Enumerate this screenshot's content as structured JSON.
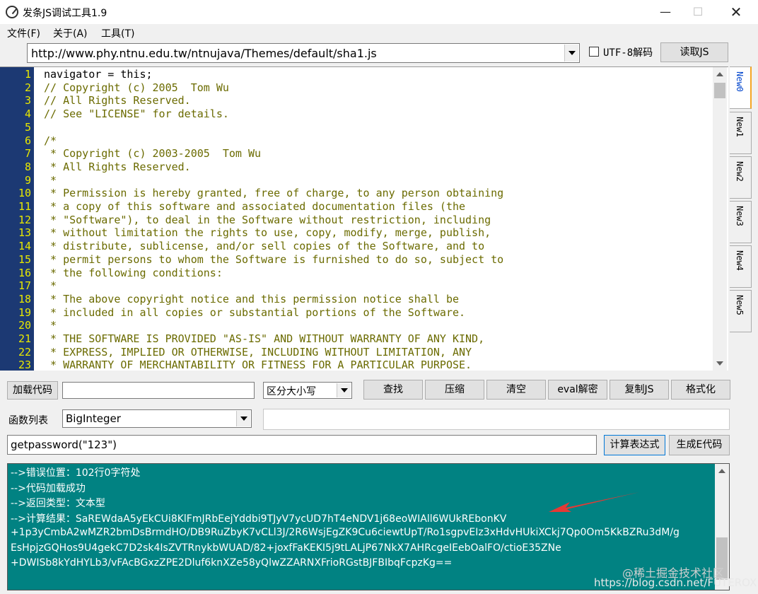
{
  "window": {
    "title": "发条JS调试工具1.9",
    "minimize": "—",
    "maximize": "☐",
    "close": "✕"
  },
  "menu": [
    "文件(F)",
    "关于(A)",
    "工具(T)"
  ],
  "url_bar": {
    "value": "http://www.phy.ntnu.edu.tw/ntnujava/Themes/default/sha1.js",
    "utf8_label": "UTF-8解码",
    "utf8_checked": false,
    "read_button": "读取JS"
  },
  "editor": {
    "line_numbers": [
      "1",
      "2",
      "3",
      "4",
      "5",
      "6",
      "7",
      "8",
      "9",
      "10",
      "11",
      "12",
      "13",
      "14",
      "15",
      "16",
      "17",
      "18",
      "19",
      "20",
      "21",
      "22",
      "23"
    ],
    "lines": [
      "navigator = this;",
      "// Copyright (c) 2005  Tom Wu",
      "// All Rights Reserved.",
      "// See \"LICENSE\" for details.",
      "",
      "/*",
      " * Copyright (c) 2003-2005  Tom Wu",
      " * All Rights Reserved.",
      " *",
      " * Permission is hereby granted, free of charge, to any person obtaining",
      " * a copy of this software and associated documentation files (the",
      " * \"Software\"), to deal in the Software without restriction, including",
      " * without limitation the rights to use, copy, modify, merge, publish,",
      " * distribute, sublicense, and/or sell copies of the Software, and to",
      " * permit persons to whom the Software is furnished to do so, subject to",
      " * the following conditions:",
      " *",
      " * The above copyright notice and this permission notice shall be",
      " * included in all copies or substantial portions of the Software.",
      " *",
      " * THE SOFTWARE IS PROVIDED \"AS-IS\" AND WITHOUT WARRANTY OF ANY KIND,",
      " * EXPRESS, IMPLIED OR OTHERWISE, INCLUDING WITHOUT LIMITATION, ANY",
      " * WARRANTY OF MERCHANTABILITY OR FITNESS FOR A PARTICULAR PURPOSE."
    ],
    "tabs": [
      "New0",
      "New1",
      "New2",
      "New3",
      "New4",
      "New5"
    ],
    "active_tab": "New0"
  },
  "toolbar": {
    "load_code": "加载代码",
    "load_input_value": "",
    "case_select": "区分大小写",
    "find": "查找",
    "compress": "压缩",
    "clear": "清空",
    "eval_decode": "eval解密",
    "copy_js": "复制JS",
    "format": "格式化"
  },
  "functions": {
    "label": "函数列表",
    "selected": "BigInteger"
  },
  "expression": {
    "value": "getpassword(\"123\")",
    "calc_button": "计算表达式",
    "gen_e_button": "生成E代码"
  },
  "output": {
    "lines": [
      "-->错误位置：102行0字符处",
      "-->代码加载成功",
      "-->返回类型：文本型",
      "-->计算结果：SaREWdaA5yEkCUi8KlFmJRbEejYddbi9TJyV7ycUD7hT4eNDV1j68eoWIAll6WUkREbonKV",
      "+1p3yCmbA2wMZR2bmDsBrmdHO/DB9RuZbyK7vCLl3J/2R6WsjEgZK9Cu6ciewtUpT/Ro1sgpvEIz3xHdvHUkiXCkj7Qp0Om5KkBZRu3dM/g",
      "EsHpjzGQHos9U4gekC7D2sk4IsZVTRnykbWUAD/82+joxfFaKEKI5j9tLALjP67NkX7AHRcgeIEebOalFO/ctioE35ZNe",
      "+DWISb8kYdHYLb3/vFAcBGxzZPE2Dluf6knXZe58yQlwZZARNXFrioRGstBJFBIbqFcpzKg=="
    ],
    "annotation_color": "#e53935",
    "background_color": "#018282"
  },
  "watermark": {
    "line1": "@稀土掘金技术社区",
    "line2": "https://blog.csdn.net/FUTEROX"
  }
}
